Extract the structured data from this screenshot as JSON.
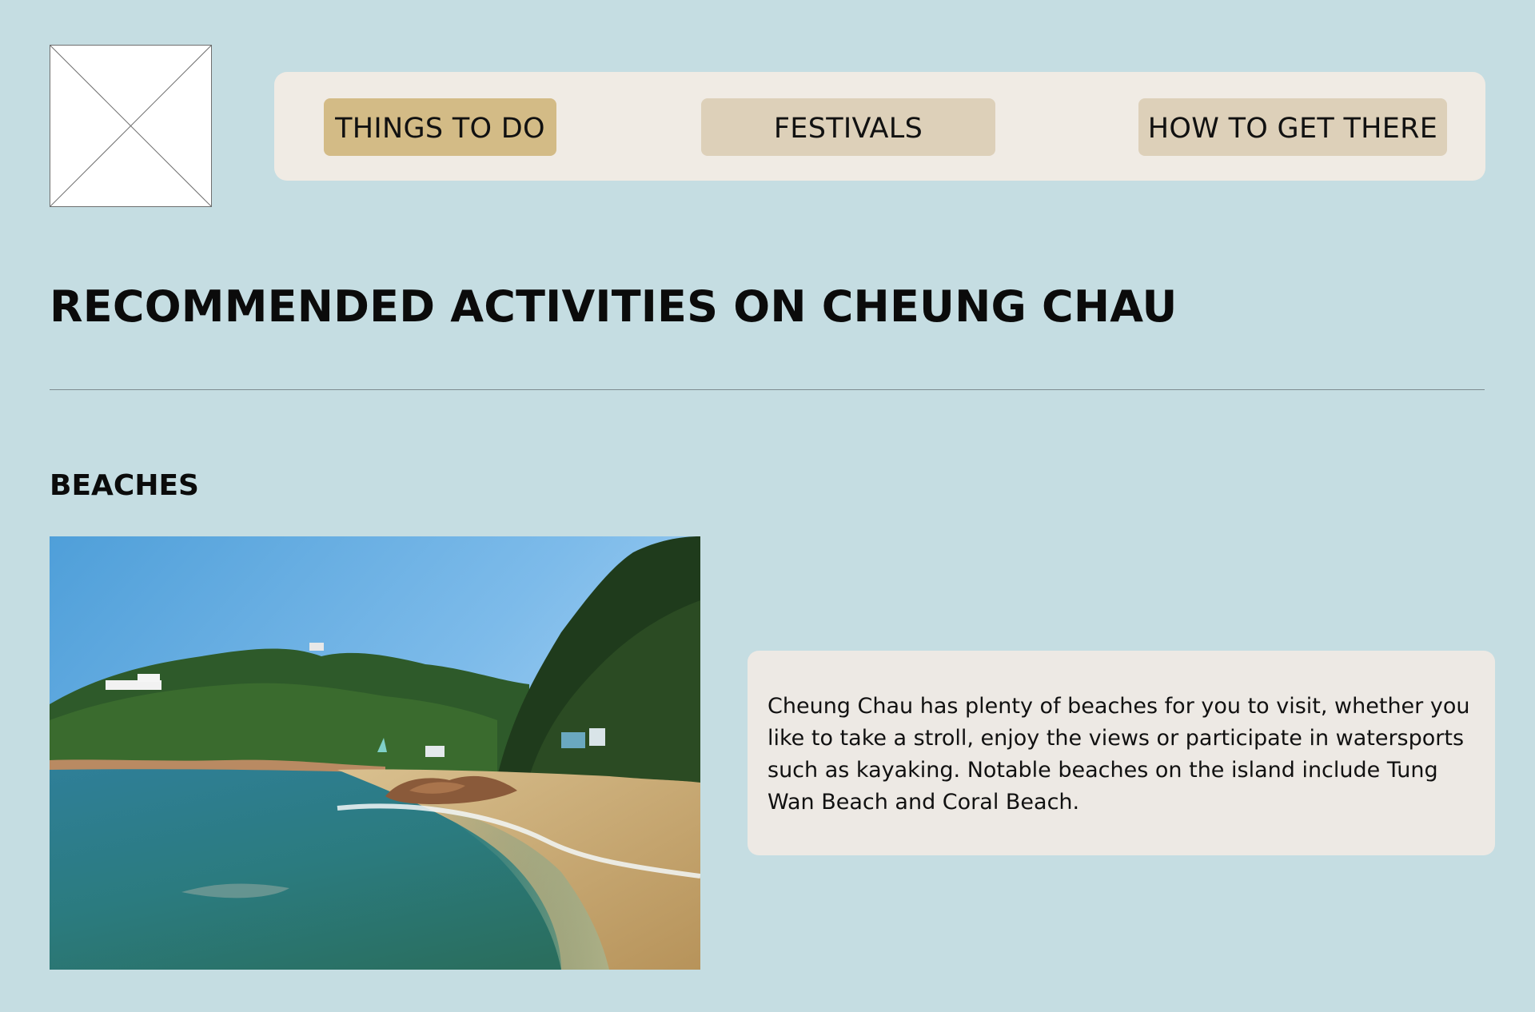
{
  "logo": {
    "icon": "image-placeholder-icon"
  },
  "nav": {
    "items": [
      {
        "label": "THINGS TO DO",
        "active": true
      },
      {
        "label": "FESTIVALS",
        "active": false
      },
      {
        "label": "HOW TO GET THERE",
        "active": false
      }
    ]
  },
  "page": {
    "title": "RECOMMENDED ACTIVITIES ON CHEUNG CHAU"
  },
  "section": {
    "title": "BEACHES",
    "description": "Cheung Chau has plenty of beaches for you to visit, whether you like to take a stroll, enjoy the views or participate in watersports such as kayaking. Notable beaches on the island include Tung Wan Beach and Coral Beach."
  },
  "colors": {
    "background": "#c5dde2",
    "nav_bar": "#f0ebe4",
    "nav_active": "#d3bb86",
    "nav_idle": "#ddd0b9",
    "card": "#ede9e4"
  }
}
